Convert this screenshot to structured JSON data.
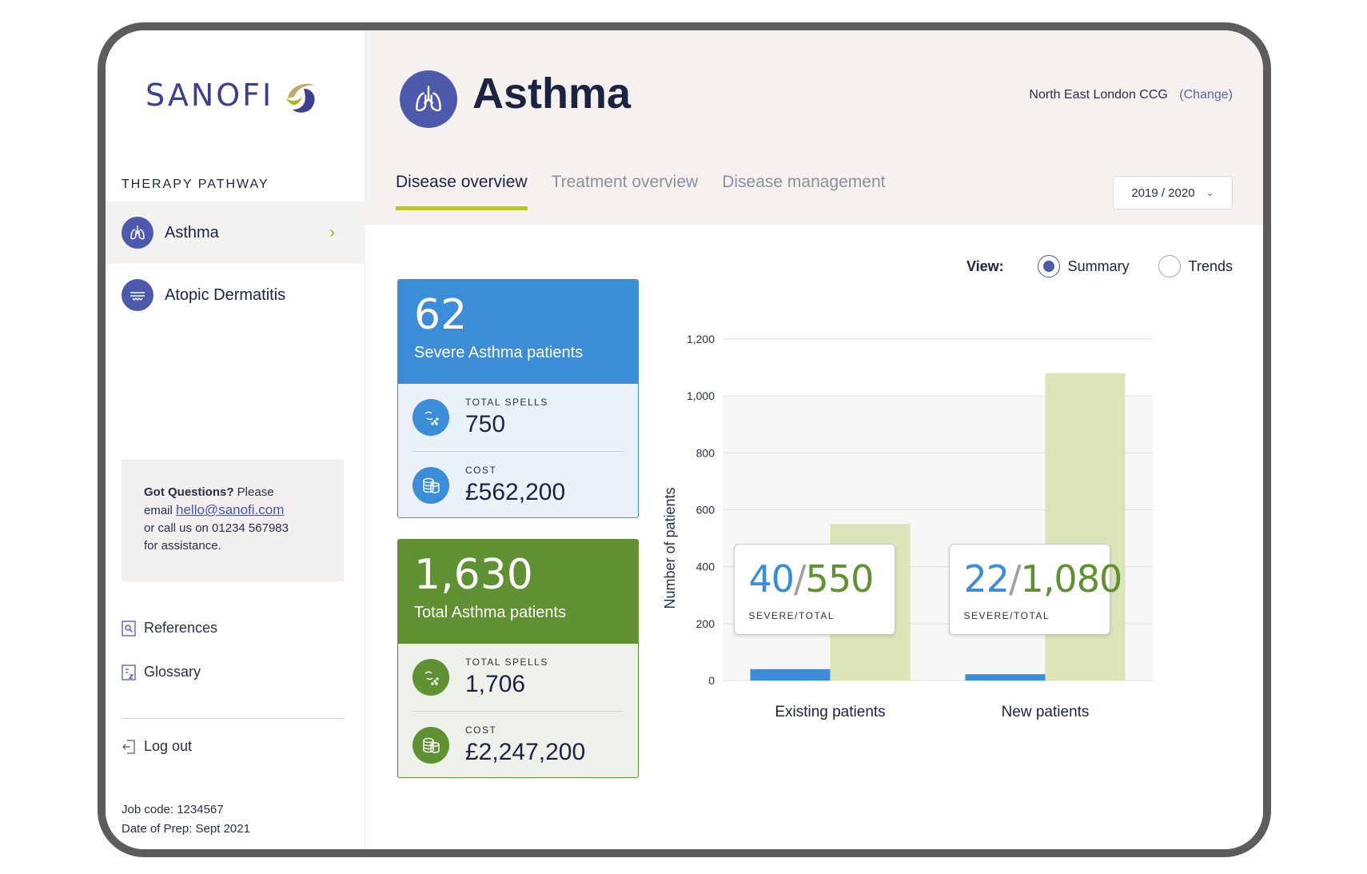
{
  "brand": {
    "logo_text": "SANOFI"
  },
  "sidebar": {
    "section_title": "THERAPY PATHWAY",
    "items": [
      {
        "label": "Asthma",
        "icon": "lungs-icon",
        "active": true
      },
      {
        "label": "Atopic Dermatitis",
        "icon": "skin-icon",
        "active": false
      }
    ],
    "help": {
      "bold": "Got Questions?",
      "text1": " Please",
      "text2": "email ",
      "email": "hello@sanofi.com",
      "text3": "or call us on 01234 567983",
      "text4": "for assistance."
    },
    "links": {
      "references": "References",
      "glossary": "Glossary",
      "logout": "Log out"
    },
    "footer": {
      "job_code": "Job code: 1234567",
      "date_prep": "Date of Prep: Sept 2021"
    }
  },
  "header": {
    "title": "Asthma",
    "ccg": "North East London CCG",
    "change_label": "(Change)",
    "tabs": [
      {
        "label": "Disease overview",
        "active": true
      },
      {
        "label": "Treatment overview",
        "active": false
      },
      {
        "label": "Disease management",
        "active": false
      }
    ],
    "year": "2019 / 2020"
  },
  "view": {
    "label": "View:",
    "options": [
      "Summary",
      "Trends"
    ],
    "selected": "Summary"
  },
  "cards": {
    "severe": {
      "number": "62",
      "subtitle": "Severe Asthma patients",
      "spells_label": "TOTAL SPELLS",
      "spells": "750",
      "cost_label": "COST",
      "cost": "£562,200"
    },
    "total": {
      "number": "1,630",
      "subtitle": "Total Asthma patients",
      "spells_label": "TOTAL SPELLS",
      "spells": "1,706",
      "cost_label": "COST",
      "cost": "£2,247,200"
    }
  },
  "colors": {
    "severe": "#3a8dd6",
    "total": "#dbe3b9",
    "accent": "#4d5aab",
    "green": "#5f9031"
  },
  "chart_data": {
    "type": "bar",
    "categories": [
      "Existing patients",
      "New patients"
    ],
    "series": [
      {
        "values": [
          40,
          22
        ]
      },
      {
        "values": [
          550,
          1080
        ]
      }
    ],
    "ylabel": "Number of patients",
    "yticks": [
      "0",
      "200",
      "400",
      "600",
      "800",
      "1,000",
      "1,200"
    ],
    "ylim": [
      0,
      1200
    ],
    "callouts": [
      {
        "severe": "40",
        "total": "550",
        "label": "SEVERE/TOTAL"
      },
      {
        "severe": "22",
        "total": "1,080",
        "label": "SEVERE/TOTAL"
      }
    ]
  }
}
